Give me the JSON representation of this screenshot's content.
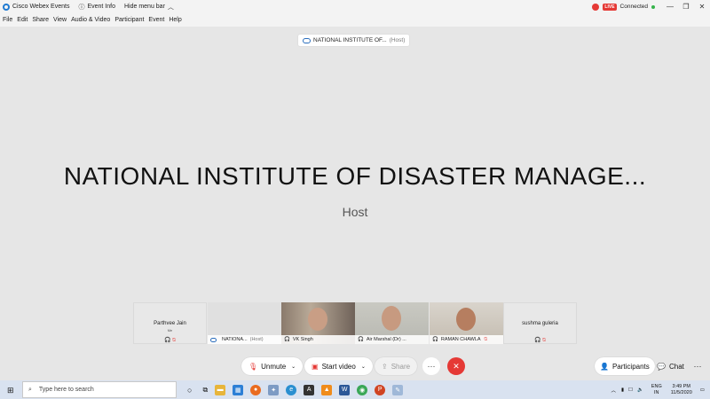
{
  "titlebar": {
    "app_title": "Cisco Webex Events",
    "event_info": "Event Info",
    "hide_menu_bar": "Hide menu bar",
    "live_label": "LIVE",
    "connected": "Connected"
  },
  "menu": [
    "File",
    "Edit",
    "Share",
    "View",
    "Audio & Video",
    "Participant",
    "Event",
    "Help"
  ],
  "stage": {
    "chip_name": "NATIONAL INSTITUTE OF...",
    "chip_role": "(Host)",
    "big_name": "NATIONAL INSTITUTE OF DISASTER MANAGE...",
    "big_role": "Host"
  },
  "participants": [
    {
      "name": "Parthvee Jain",
      "sub": "Me"
    },
    {
      "name": "NATIONA...",
      "role": "(Host)"
    },
    {
      "name": "VK Singh"
    },
    {
      "name": "Air Marshal (Dr) ..."
    },
    {
      "name": "RAMAN CHAWLA"
    },
    {
      "name": "sushma guleria"
    }
  ],
  "controls": {
    "unmute": "Unmute",
    "start_video": "Start video",
    "share": "Share",
    "more": "···",
    "end": "✕",
    "participants": "Participants",
    "chat": "Chat"
  },
  "taskbar": {
    "search_placeholder": "Type here to search",
    "lang_top": "ENG",
    "lang_bottom": "IN",
    "time": "3:49 PM",
    "date": "11/5/2020"
  },
  "colors": {
    "accent_red": "#e53935",
    "brand_blue": "#1f7ad1",
    "connected_green": "#35b34a"
  }
}
